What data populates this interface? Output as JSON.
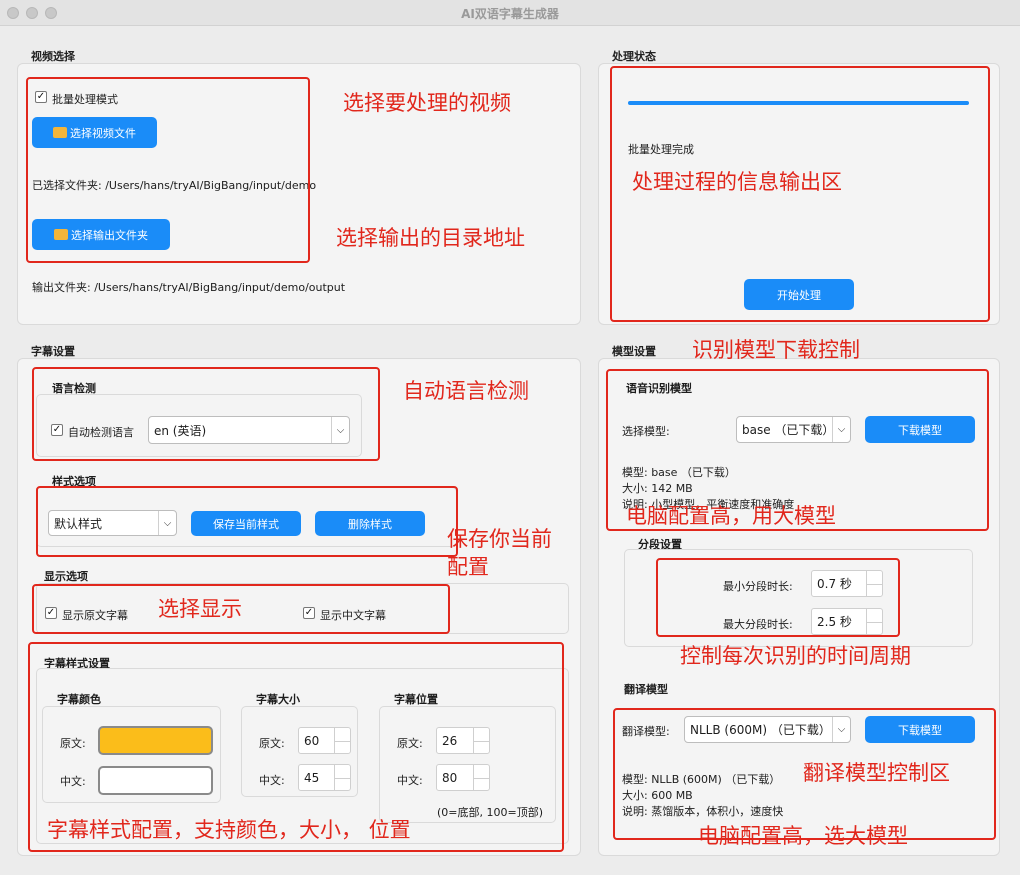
{
  "window": {
    "title": "AI双语字幕生成器"
  },
  "video_select": {
    "group_title": "视频选择",
    "batch_label": "批量处理模式",
    "batch_checked": true,
    "select_video_btn": "选择视频文件",
    "selected_folder": "已选择文件夹: /Users/hans/tryAI/BigBang/input/demo",
    "select_output_btn": "选择输出文件夹",
    "output_folder": "输出文件夹: /Users/hans/tryAI/BigBang/input/demo/output"
  },
  "status": {
    "group_title": "处理状态",
    "progress": 1.0,
    "message": "批量处理完成",
    "start_btn": "开始处理"
  },
  "subtitle_settings": {
    "group_title": "字幕设置",
    "lang_detect": {
      "title": "语言检测",
      "auto_label": "自动检测语言",
      "auto_checked": true,
      "language": "en (英语)"
    },
    "style_options": {
      "title": "样式选项",
      "style": "默认样式",
      "save_btn": "保存当前样式",
      "delete_btn": "删除样式"
    },
    "display_options": {
      "title": "显示选项",
      "show_original": "显示原文字幕",
      "show_chinese": "显示中文字幕",
      "original_checked": true,
      "chinese_checked": true
    },
    "style_settings": {
      "title": "字幕样式设置",
      "color_title": "字幕颜色",
      "original_label": "原文:",
      "chinese_label": "中文:",
      "original_color": "#fbbd1a",
      "chinese_color": "#ffffff",
      "size_title": "字幕大小",
      "size_original": "60",
      "size_chinese": "45",
      "position_title": "字幕位置",
      "pos_original": "26",
      "pos_chinese": "80",
      "pos_hint": "(0=底部, 100=顶部)"
    }
  },
  "model_settings": {
    "group_title": "模型设置",
    "asr": {
      "title": "语音识别模型",
      "select_label": "选择模型:",
      "model": "base （已下载）",
      "download_btn": "下载模型",
      "info_model": "模型: base （已下载）",
      "info_size": "大小: 142 MB",
      "info_desc": "说明: 小型模型，平衡速度和准确度"
    },
    "segment": {
      "title": "分段设置",
      "min_label": "最小分段时长:",
      "min_value": "0.7 秒",
      "max_label": "最大分段时长:",
      "max_value": "2.5 秒"
    },
    "translation": {
      "group_title": "翻译模型",
      "select_label": "翻译模型:",
      "model": "NLLB (600M) （已下载）",
      "download_btn": "下载模型",
      "info_model": "模型: NLLB (600M) （已下载）",
      "info_size": "大小: 600 MB",
      "info_desc": "说明: 蒸馏版本，体积小，速度快"
    }
  },
  "annotations": {
    "a1": "选择要处理的视频",
    "a2": "选择输出的目录地址",
    "a3": "处理过程的信息输出区",
    "a4": "识别模型下载控制",
    "a5": "自动语言检测",
    "a6": "电脑配置高，用大模型",
    "a7": "保存你当前",
    "a7b": "配置",
    "a8": "选择显示",
    "a9": "控制每次识别的时间周期",
    "a10": "翻译模型控制区",
    "a11": "字幕样式配置，支持颜色，大小，  位置",
    "a12": "电脑配置高，选大模型"
  }
}
